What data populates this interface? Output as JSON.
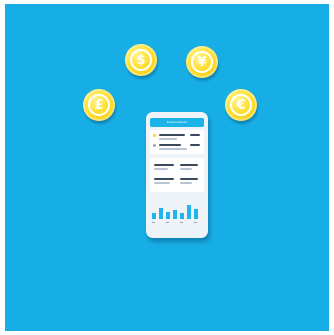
{
  "scene": {
    "background_color": "#17aee6",
    "coin_color": "#ffe03a"
  },
  "coins": [
    {
      "name": "pound-coin",
      "symbol": "£"
    },
    {
      "name": "dollar-coin",
      "symbol": "$"
    },
    {
      "name": "yen-coin",
      "symbol": "¥"
    },
    {
      "name": "euro-coin",
      "symbol": "€"
    }
  ],
  "phone": {
    "header_title": "Finance Report",
    "chart_bars": [
      0.35,
      0.7,
      0.45,
      0.55,
      0.4,
      0.85,
      0.6
    ]
  }
}
